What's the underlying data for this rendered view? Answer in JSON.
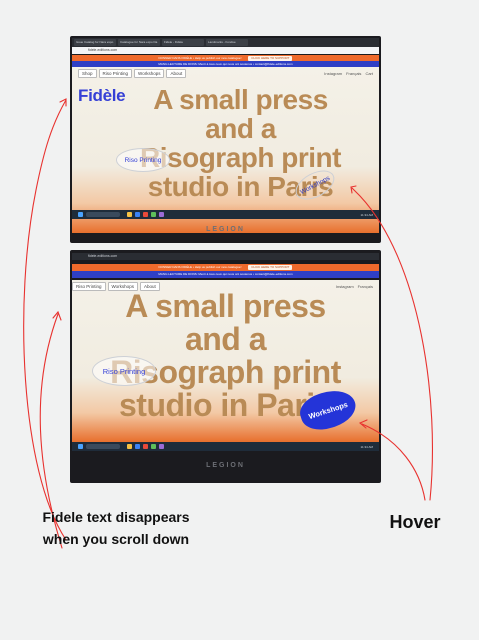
{
  "browser": {
    "tabs": [
      "Issue Catalog for Nara expo",
      "Catalogue for Nara expo  Da",
      "Fidèle - Fidèle",
      "Landmarks - Fondue"
    ],
    "url": "fidele-editions.com"
  },
  "banners": {
    "orange_text": "DONNER DANS FIDÈLE • Help us publish our new catalogue!",
    "support_button": "CLICK HERE TO SUPPORT",
    "blue_text": "MANU-LECTURE DE DONS: Merci à tous ceux qui nous ont soutenus • contact@fidele-editions.com"
  },
  "nav": {
    "items": [
      "Shop",
      "Riso Printing",
      "Workshops",
      "About"
    ],
    "right_items": [
      "Instagram",
      "Français",
      "Cart"
    ]
  },
  "site": {
    "logo": "Fidèle",
    "headline": [
      "A small press",
      "and a",
      "Risograph print",
      "studio in Paris"
    ],
    "bubble_riso": "Riso Printing",
    "bubble_workshops": "Workshops"
  },
  "taskbar": {
    "clock": "11:34 AM"
  },
  "bezel": "LEGION",
  "annotations": {
    "left": "Fidele text disappears when you scroll down",
    "right": "Hover"
  },
  "colors": {
    "brand_blue": "#3540d6",
    "headline_tan": "#b98b56",
    "banner_orange": "#ef6a2c",
    "annotation_red": "#e8322f"
  }
}
